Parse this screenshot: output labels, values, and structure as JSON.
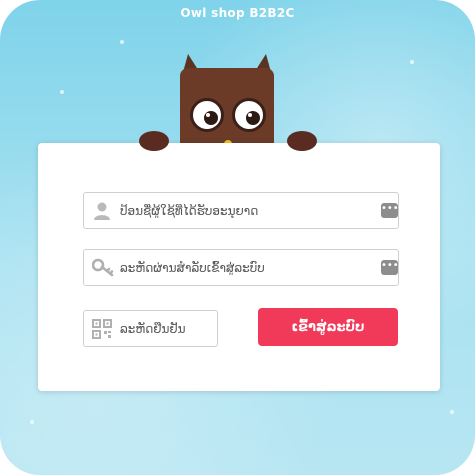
{
  "app": {
    "title": "Owl shop B2B2C"
  },
  "form": {
    "username": {
      "placeholder": "ປ້ອນຊື່ຜູ້ໃຊ້ທີ່ໄດ້ຮັບອະນຸຍາດ",
      "value": ""
    },
    "password": {
      "placeholder": "ລະຫັດຜ່ານສຳລັບເຂົ້າສູ່ລະບົບ",
      "value": ""
    },
    "captcha": {
      "placeholder": "ລະຫັດຢືນຢັນ",
      "value": ""
    },
    "submit_label": "ເຂົ້າສູ່ລະບົບ",
    "autofill_glyph": "•••"
  },
  "icons": {
    "username": "user-icon",
    "password": "key-icon",
    "captcha": "qr-code-icon",
    "autofill": "autofill-dots-icon"
  },
  "colors": {
    "background_top": "#7fd3ea",
    "background_bottom": "#b7e6f2",
    "button": "#f13a59",
    "owl": "#6b3b28"
  }
}
